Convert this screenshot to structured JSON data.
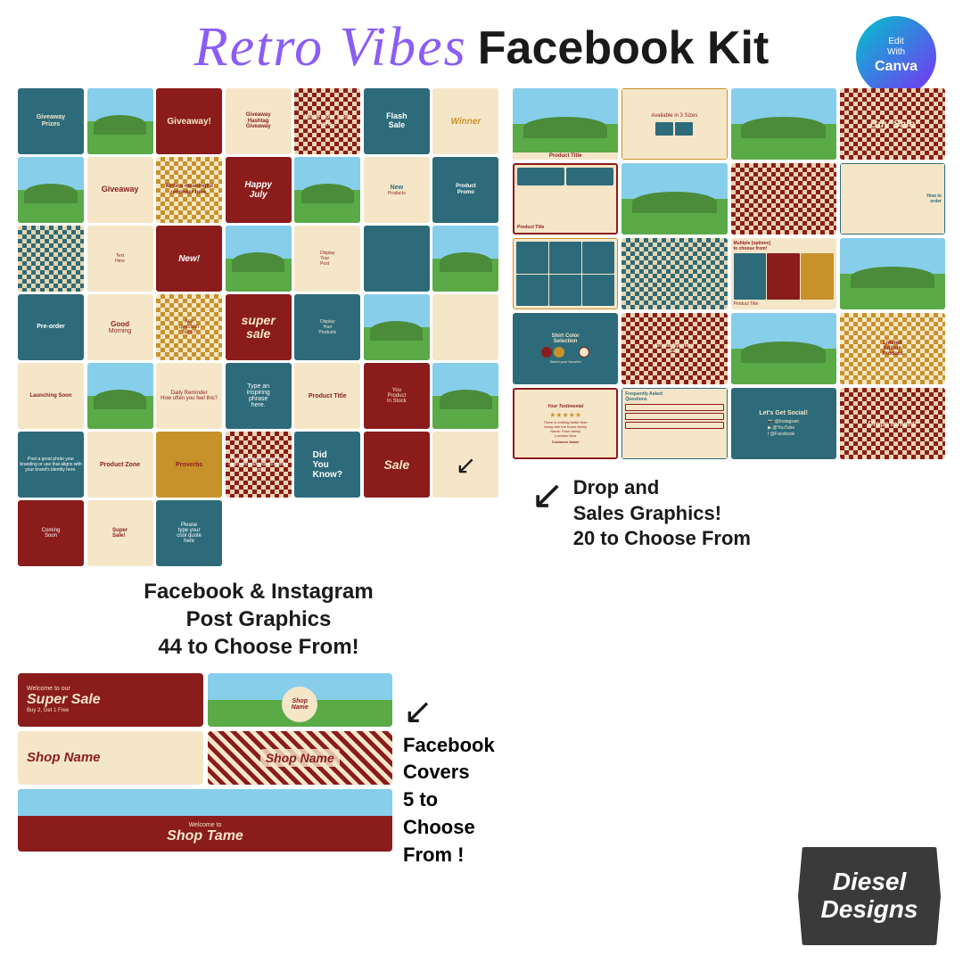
{
  "header": {
    "retro_vibes": "Retro Vibes",
    "facebook_kit": "Facebook Kit",
    "canva_edit": "Edit",
    "canva_with": "With",
    "canva_brand": "Canva"
  },
  "post_graphics": {
    "description_line1": "Facebook & Instagram",
    "description_line2": "Post Graphics",
    "description_line3": "44 to Choose From!"
  },
  "sales_graphics": {
    "description_line1": "Drop and",
    "description_line2": "Sales Graphics!",
    "description_line3": "20 to Choose From"
  },
  "covers": {
    "description_line1": "Facebook Covers",
    "description_line2": "5 to Choose From !",
    "shop_name_1": "Shop Name",
    "shop_name_2": "Shop Name",
    "shop_name_3": "Shop Name",
    "super_sale": "Super Sale",
    "welcome_to": "Welcome to",
    "shop_tame": "Shop Tame"
  },
  "diesel_designs": {
    "line1": "Diesel",
    "line2": "Designs"
  },
  "cell_labels": {
    "giveaway": "Giveaway",
    "giveaway_hashtag": "Giveaway Hashtag Giveaway",
    "flash_sale": "Flash Sale",
    "winner": "Winner",
    "happy_july": "Happy July",
    "new": "New!",
    "products": "Products",
    "good_morning": "Good Morning",
    "ask_question": "Ask question here?",
    "super_sale": "super sale",
    "product_title": "Product Title",
    "launching_soon": "Launching Soon",
    "tip_tip": "Tip Tip",
    "did_you_know": "Did You Know?",
    "sale": "Sale",
    "coming_soon": "Coming Soon",
    "super_sale2": "Super Sale!",
    "please_type": "Please type your cool quote here",
    "available_3_sizes": "Available in 3 Sizes",
    "buy_sale": "Buy Sale",
    "how_to_order": "How to order",
    "multiple_options": "Multiple [options] to choose from!",
    "shirt_color": "Shirt Color Selection",
    "grand_opening": "Grand Opening Sale",
    "limited_edition": "Limited Edition Product",
    "testimonial": "Your Testimonial",
    "frequently_asked": "Frequently Asked Questions",
    "lets_get_social": "Let's Get Social!",
    "drops_tonight": "Drops tonight!"
  }
}
